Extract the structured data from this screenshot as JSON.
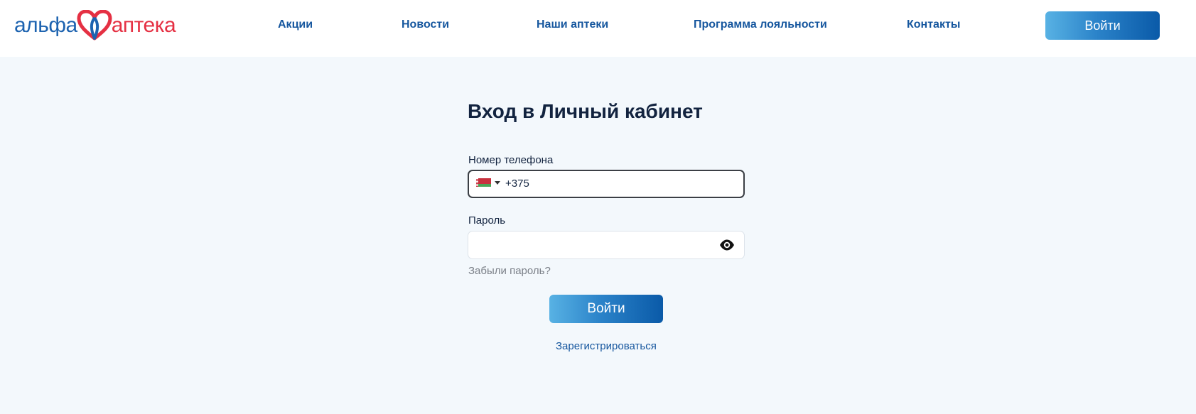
{
  "logo": {
    "left_text": "альфа",
    "right_text": "аптека",
    "brand_blue": "#1d63b0",
    "brand_red": "#e53043",
    "icon": "heart-logo-icon"
  },
  "nav": {
    "items": [
      {
        "label": "Акции"
      },
      {
        "label": "Новости"
      },
      {
        "label": "Наши аптеки"
      },
      {
        "label": "Программа лояльности"
      },
      {
        "label": "Контакты"
      }
    ],
    "login_label": "Войти",
    "color": "#15569e"
  },
  "login_form": {
    "title": "Вход в Личный кабинет",
    "phone_label": "Номер телефона",
    "phone_value": "+375",
    "country_flag": "belarus-flag-icon",
    "password_label": "Пароль",
    "password_value": "",
    "show_password_icon": "eye-icon",
    "forgot_label": "Забыли пароль?",
    "submit_label": "Войти",
    "register_label": "Зарегистрироваться"
  },
  "colors": {
    "background": "#f3f8fc",
    "header_bg": "#ffffff",
    "title": "#12233f",
    "button_gradient_start": "#58b2e4",
    "button_gradient_end": "#0a5aa8",
    "muted_text": "#7b8088"
  }
}
